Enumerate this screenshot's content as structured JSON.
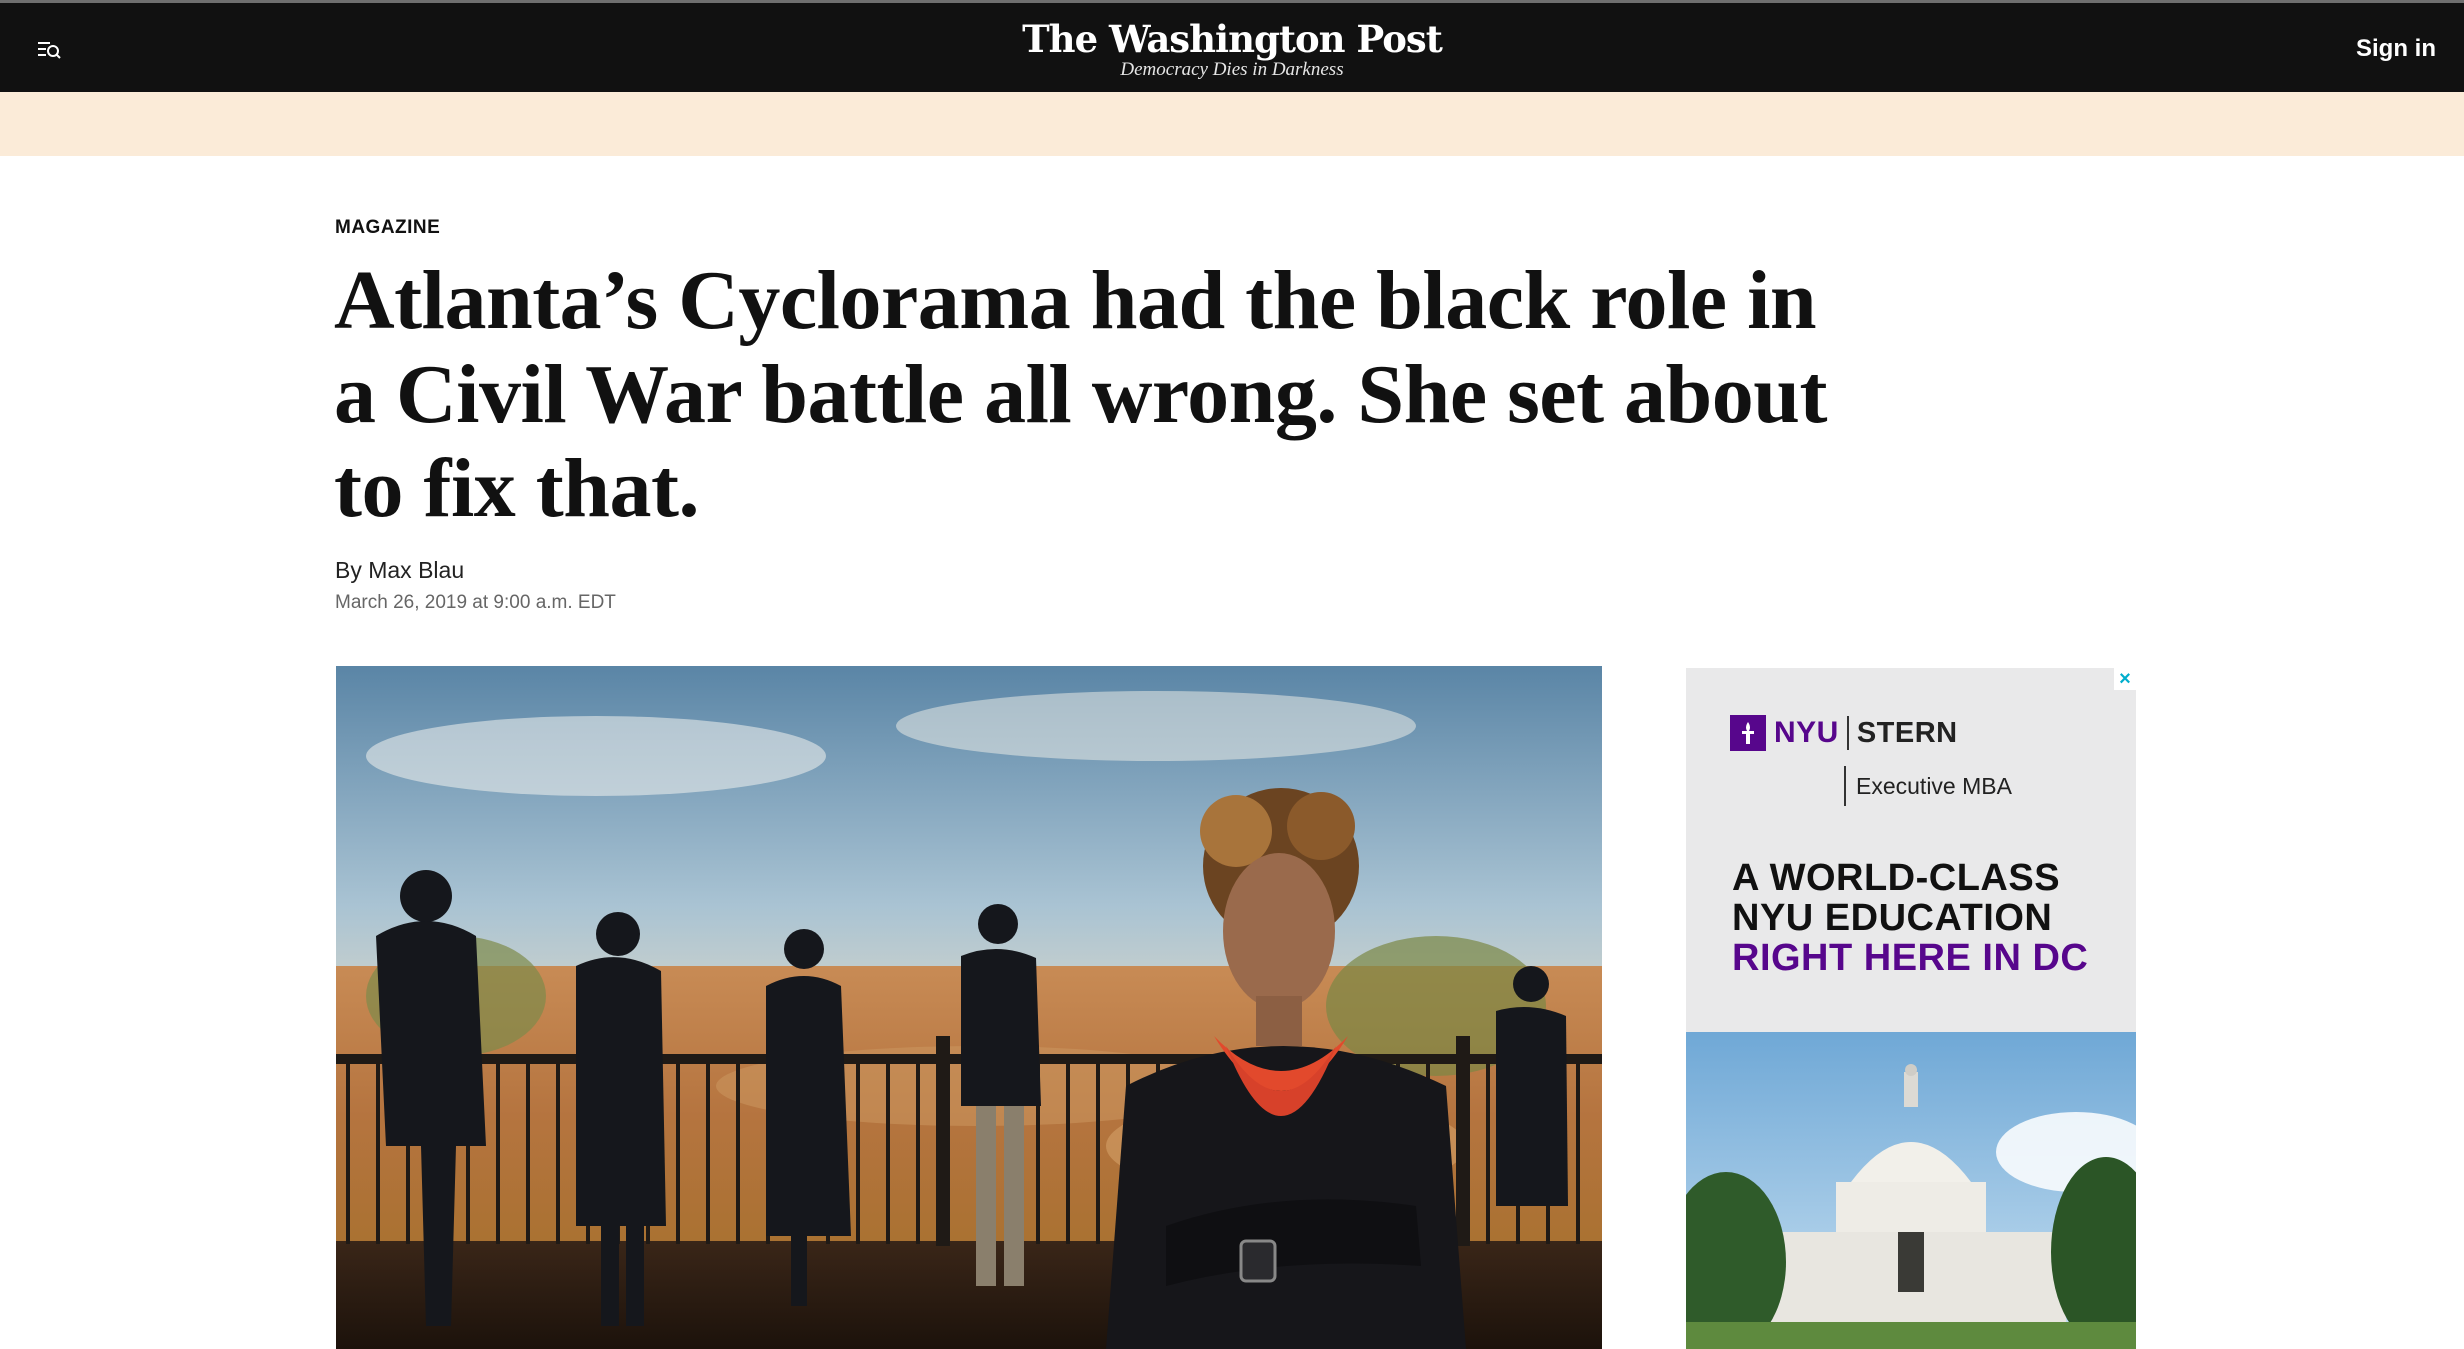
{
  "header": {
    "brand": "The Washington Post",
    "tagline": "Democracy Dies in Darkness",
    "sign_in": "Sign in",
    "menu_icon": "menu-search-icon"
  },
  "article": {
    "section": "MAGAZINE",
    "headline": "Atlanta’s Cyclorama had the black role in a Civil War battle all wrong. She set about to fix that.",
    "byline_prefix": "By ",
    "author": "Max Blau",
    "date": "March 26, 2019 at 9:00 a.m. EDT"
  },
  "ad": {
    "close_icon": "close-icon",
    "brand_nyu": "NYU",
    "brand_stern": "STERN",
    "program": "Executive MBA",
    "line1": "A WORLD-CLASS",
    "line2": "NYU EDUCATION",
    "line3": "RIGHT HERE IN DC"
  },
  "colors": {
    "nav_bg": "#111111",
    "promo_band": "#fbebd8",
    "nyu_purple": "#57068c",
    "ad_close": "#00aecd"
  }
}
